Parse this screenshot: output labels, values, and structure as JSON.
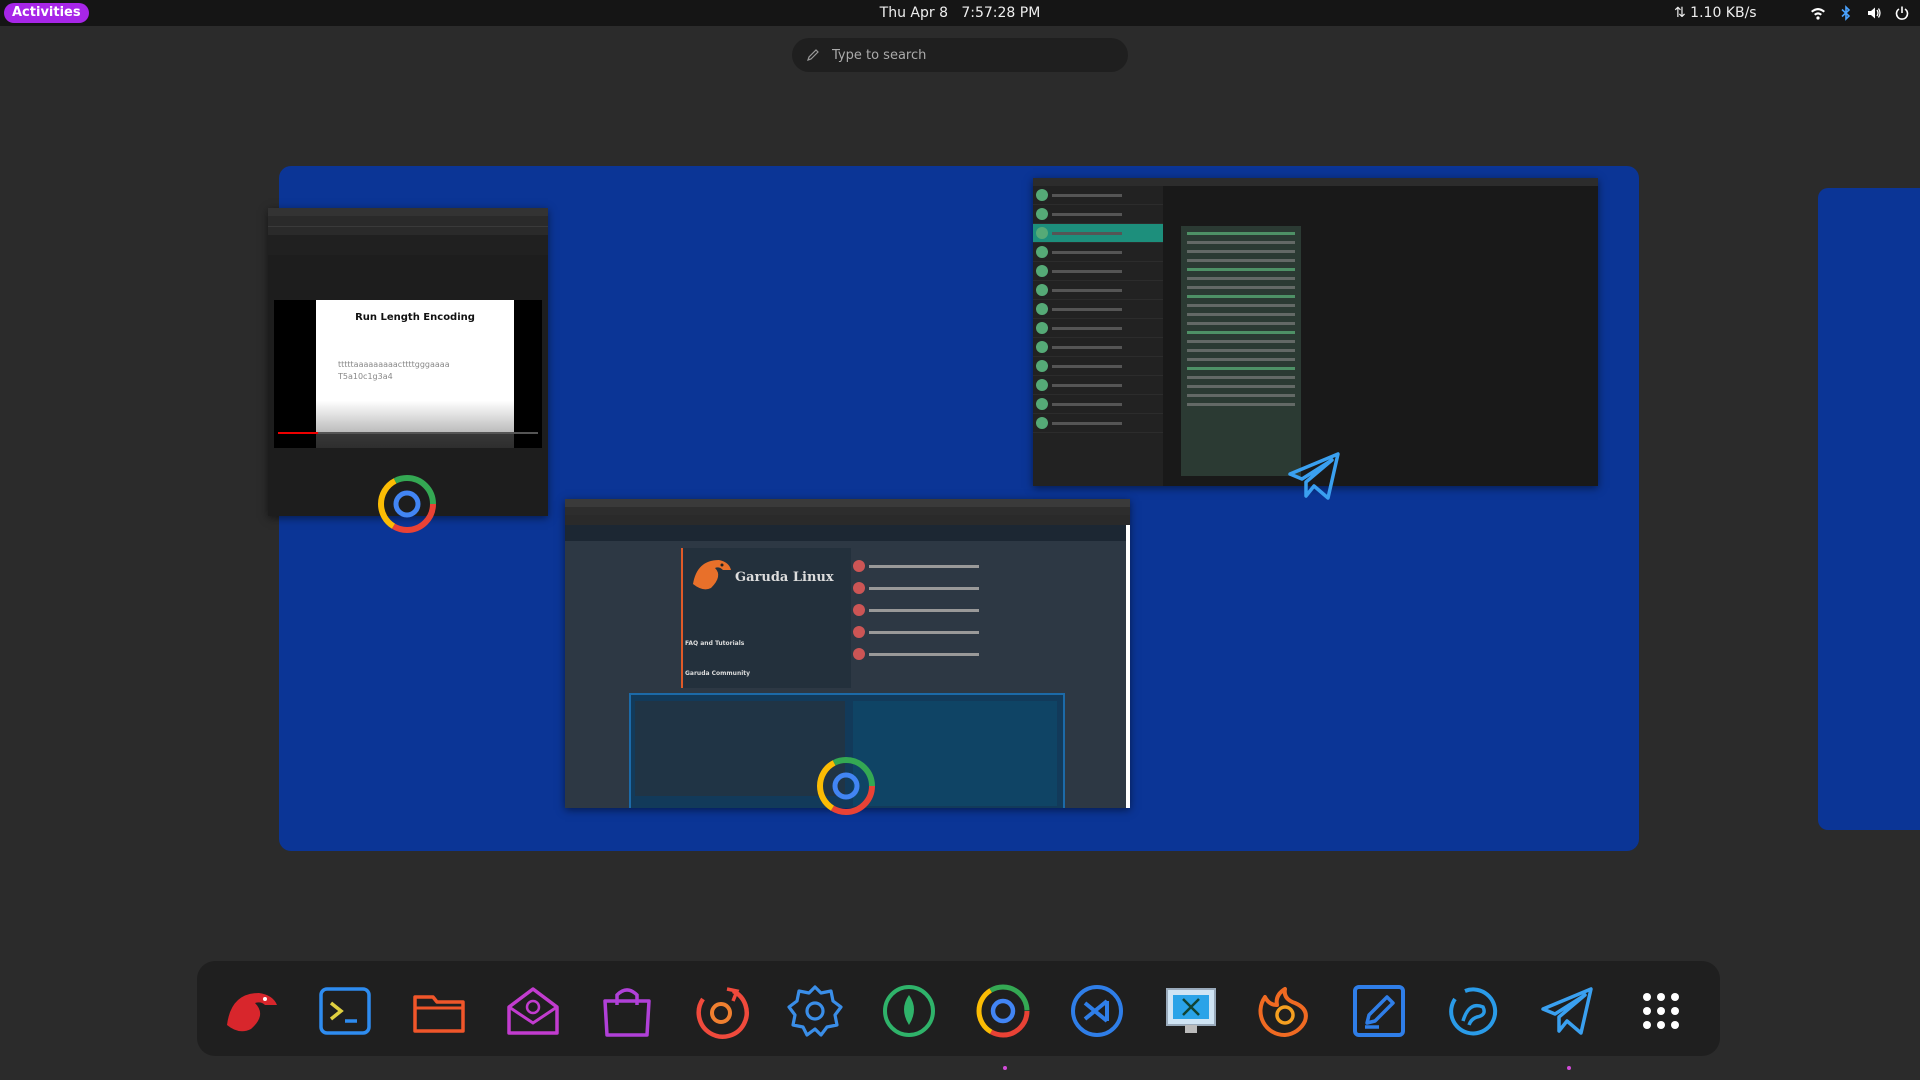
{
  "topbar": {
    "activities_label": "Activities",
    "date": "Thu Apr 8",
    "time": "7:57:28 PM",
    "netspeed": "⇅ 1.10 KB/s",
    "tray_icons": [
      "wifi-icon",
      "bluetooth-icon",
      "volume-icon",
      "power-icon"
    ]
  },
  "search": {
    "placeholder": "Type to search"
  },
  "overview": {
    "windows": [
      {
        "app": "chrome",
        "slide_title": "Run Length Encoding",
        "slide_line1": "tttttaaaaaaaaacttttgggaaaa",
        "slide_line2": "T5a10c1g3a4"
      },
      {
        "app": "telegram"
      },
      {
        "app": "chrome",
        "site_name": "Garuda Linux",
        "section_faq": "FAQ and Tutorials",
        "section_community": "Garuda Community"
      }
    ]
  },
  "dock": {
    "items": [
      "garuda-icon",
      "terminal-icon",
      "files-icon",
      "mail-icon",
      "software-store-icon",
      "timeshift-icon",
      "settings-icon",
      "gnome-disks-icon",
      "chrome-icon",
      "vscode-icon",
      "screenshot-tool-icon",
      "firefox-icon",
      "text-editor-icon",
      "mysql-workbench-icon",
      "telegram-icon",
      "app-grid-icon"
    ]
  },
  "colors": {
    "accent": "#a726e8",
    "workspace": "#0b3596",
    "panel": "#151515",
    "dock": "#1f1f1f"
  }
}
